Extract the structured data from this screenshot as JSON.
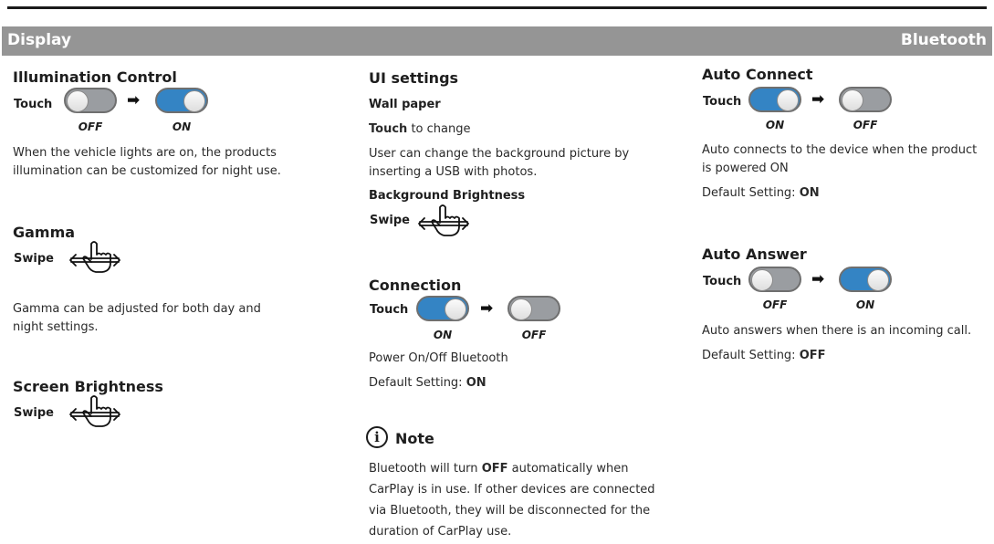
{
  "header": {
    "left_title": "Display",
    "right_title": "Bluetooth"
  },
  "illumination": {
    "title": "Illumination Control",
    "action": "Touch",
    "state_from": "OFF",
    "state_to": "ON",
    "description": "When the vehicle lights are on, the products illumination can be customized for night use."
  },
  "gamma": {
    "title": "Gamma",
    "action": "Swipe",
    "description": "Gamma can be adjusted for both day and night settings."
  },
  "screen_brightness": {
    "title": "Screen Brightness",
    "action": "Swipe"
  },
  "ui_settings": {
    "title": "UI settings",
    "wallpaper_label": "Wall paper",
    "touch_action": "Touch",
    "touch_text": "to change",
    "wallpaper_description": "User can change the background picture by inserting a USB with photos.",
    "background_brightness_label": "Background Brightness",
    "swipe_action": "Swipe"
  },
  "connection": {
    "title": "Connection",
    "action": "Touch",
    "state_from": "ON",
    "state_to": "OFF",
    "description": "Power On/Off Bluetooth",
    "default_prefix": "Default Setting:",
    "default_value": "ON"
  },
  "note": {
    "title": "Note",
    "text_before": "Bluetooth will turn",
    "text_bold": "OFF",
    "text_after": "automatically when CarPlay is in use.  If other devices are connected via Bluetooth, they will be disconnected for the duration of CarPlay use."
  },
  "auto_connect": {
    "title": "Auto Connect",
    "action": "Touch",
    "state_from": "ON",
    "state_to": "OFF",
    "description": "Auto connects to the device when the product is powered ON",
    "default_prefix": "Default Setting:",
    "default_value": "ON"
  },
  "auto_answer": {
    "title": "Auto Answer",
    "action": "Touch",
    "state_from": "OFF",
    "state_to": "ON",
    "description": "Auto answers when there is an incoming call.",
    "default_prefix": "Default Setting:",
    "default_value": "OFF"
  },
  "colors": {
    "header_bar": "#959595",
    "toggle_on": "#3484c4",
    "toggle_off": "#9a9da1"
  },
  "icons": {
    "swipe": "swipe-hand-icon",
    "arrow": "right-arrow-icon",
    "note": "info-icon"
  }
}
